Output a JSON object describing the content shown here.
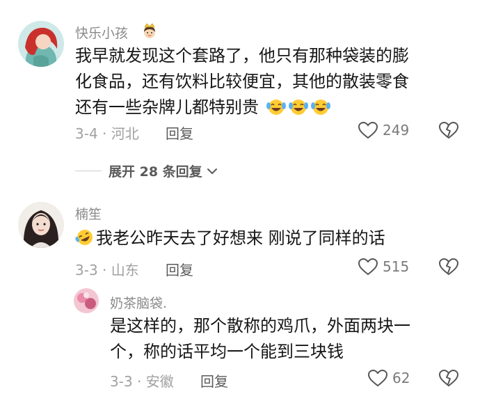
{
  "comments": [
    {
      "username": "快乐小孩",
      "content_lines": [
        "我早就发现这个套路了，他只有那种袋装的膨",
        "化食品，还有饮料比较便宜，其他的散装零食",
        "还有一些杂牌儿都特别贵"
      ],
      "date_location": "3-4 · 河北",
      "reply_label": "回复",
      "like_count": "249"
    },
    {
      "username": "楠笙",
      "content_lines": [
        "我老公昨天去了好想来 刚说了同样的话"
      ],
      "date_location": "3-3 · 山东",
      "reply_label": "回复",
      "like_count": "515"
    }
  ],
  "expand_replies": {
    "label": "展开 28 条回复"
  },
  "reply": {
    "username": "奶茶脑袋.",
    "content_lines": [
      "是这样的，那个散称的鸡爪，外面两块一",
      "个，称的话平均一个能到三块钱"
    ],
    "date_location": "3-3 · 安徽",
    "reply_label": "回复",
    "like_count": "62"
  },
  "colors": {
    "text": "#161616",
    "username": "#8a8a8a",
    "meta": "#a0a0a0",
    "action": "#5a5a5a"
  }
}
